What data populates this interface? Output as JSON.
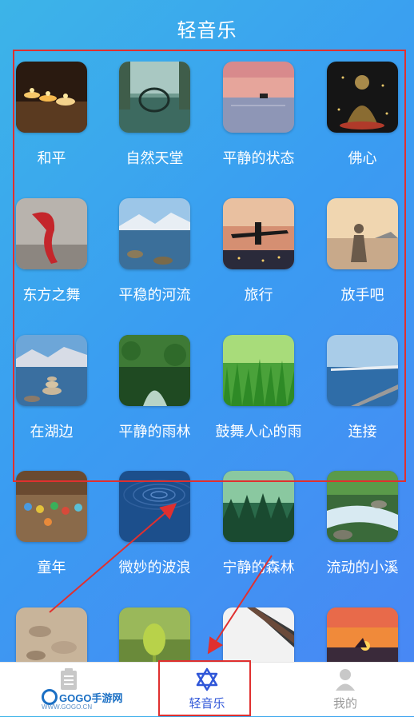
{
  "header": {
    "title": "轻音乐"
  },
  "items": [
    {
      "label": "和平",
      "icon": "candles-image"
    },
    {
      "label": "自然天堂",
      "icon": "forest-bridge-image"
    },
    {
      "label": "平静的状态",
      "icon": "sunset-lake-image"
    },
    {
      "label": "佛心",
      "icon": "buddha-image"
    },
    {
      "label": "东方之舞",
      "icon": "dancer-image"
    },
    {
      "label": "平稳的河流",
      "icon": "river-image"
    },
    {
      "label": "旅行",
      "icon": "airplane-image"
    },
    {
      "label": "放手吧",
      "icon": "meditation-beach-image"
    },
    {
      "label": "在湖边",
      "icon": "lakeside-stones-image"
    },
    {
      "label": "平静的雨林",
      "icon": "rainforest-image"
    },
    {
      "label": "鼓舞人心的雨",
      "icon": "grass-rain-image"
    },
    {
      "label": "连接",
      "icon": "pier-image"
    },
    {
      "label": "童年",
      "icon": "marbles-image"
    },
    {
      "label": "微妙的波浪",
      "icon": "water-ripple-image"
    },
    {
      "label": "宁静的森林",
      "icon": "misty-forest-image"
    },
    {
      "label": "流动的小溪",
      "icon": "stream-image"
    },
    {
      "label": "",
      "icon": "pebbles-image"
    },
    {
      "label": "",
      "icon": "sprout-image"
    },
    {
      "label": "",
      "icon": "roof-image"
    },
    {
      "label": "",
      "icon": "sea-sunset-image"
    }
  ],
  "tabs": [
    {
      "label": "",
      "icon": "document-icon"
    },
    {
      "label": "轻音乐",
      "icon": "star-of-david-icon",
      "active": true
    },
    {
      "label": "我的",
      "icon": "user-icon"
    }
  ],
  "watermark": {
    "text": "GOGO手游网",
    "sub": "WWW.GOGO.CN"
  },
  "colors": {
    "accent": "#2f56d8",
    "annotation": "#e0302f"
  }
}
